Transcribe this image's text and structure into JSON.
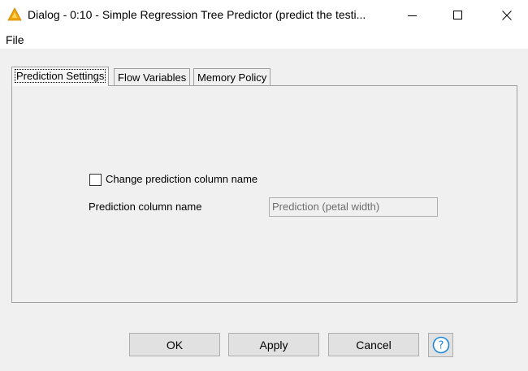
{
  "window": {
    "title": "Dialog - 0:10 - Simple Regression Tree Predictor (predict the testi...",
    "app_icon": "warning-triangle-icon",
    "controls": [
      "minimize-icon",
      "maximize-icon",
      "close-icon"
    ]
  },
  "menu": {
    "file_label": "File"
  },
  "tabs": [
    {
      "label": "Prediction Settings",
      "active": true
    },
    {
      "label": "Flow Variables",
      "active": false
    },
    {
      "label": "Memory Policy",
      "active": false
    }
  ],
  "settings": {
    "change_checkbox_label": "Change prediction column name",
    "change_checkbox_checked": false,
    "prediction_column_label": "Prediction column name",
    "prediction_column_value": "Prediction (petal width)"
  },
  "buttons": {
    "ok": "OK",
    "apply": "Apply",
    "cancel": "Cancel",
    "help_icon": "question-circle-icon"
  },
  "colors": {
    "window_bg": "#f0f0f0",
    "titlebar_bg": "#ffffff",
    "icon_warning": "#f0a30a",
    "help_blue": "#1e88d6"
  }
}
